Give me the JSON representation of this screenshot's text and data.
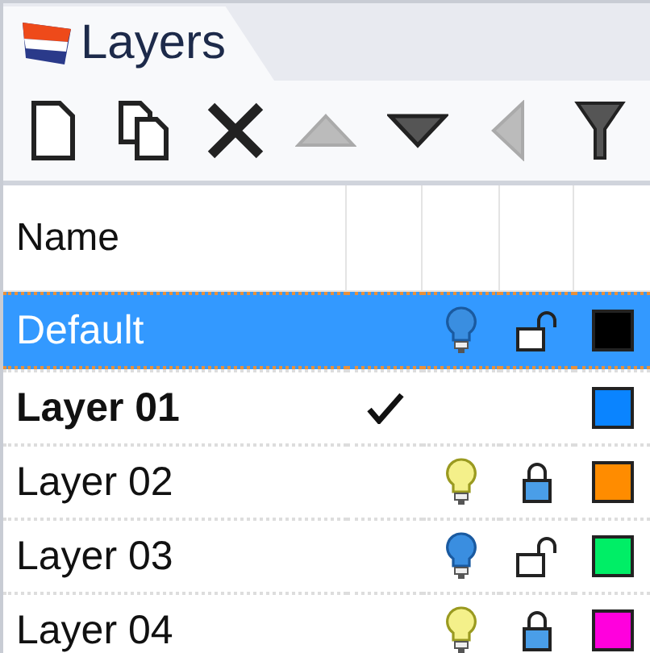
{
  "tab": {
    "label": "Layers",
    "selected": true
  },
  "toolbar": [
    {
      "kind": "new",
      "disabled": false
    },
    {
      "kind": "copy",
      "disabled": false
    },
    {
      "kind": "delete",
      "disabled": false
    },
    {
      "kind": "up",
      "disabled": true
    },
    {
      "kind": "down",
      "disabled": false
    },
    {
      "kind": "left",
      "disabled": true
    },
    {
      "kind": "filter",
      "disabled": false
    }
  ],
  "table": {
    "columns": [
      "Name"
    ],
    "rows": [
      {
        "name": "Default",
        "selected": true,
        "current": false,
        "light_on": false,
        "locked": false,
        "color": "#000000"
      },
      {
        "name": "Layer 01",
        "selected": false,
        "current": true,
        "color": "#0a84ff"
      },
      {
        "name": "Layer 02",
        "selected": false,
        "current": false,
        "light_on": true,
        "locked": true,
        "color": "#ff8c00"
      },
      {
        "name": "Layer 03",
        "selected": false,
        "current": false,
        "light_on": false,
        "locked": false,
        "color": "#00ee66"
      },
      {
        "name": "Layer 04",
        "selected": false,
        "current": false,
        "light_on": true,
        "locked": true,
        "color": "#ff00dd"
      }
    ]
  }
}
